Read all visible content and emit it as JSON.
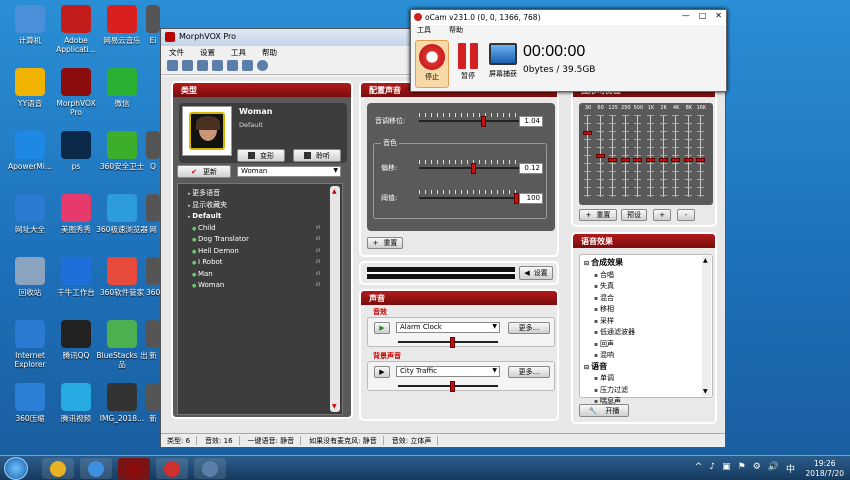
{
  "desktop_icons": [
    {
      "label": "计算机",
      "icon": "computer-icon",
      "color": "#4a8fd8",
      "col": 0,
      "row": 0
    },
    {
      "label": "Adobe Applicati...",
      "icon": "adobe-icon",
      "color": "#c31c1c",
      "col": 1,
      "row": 0
    },
    {
      "label": "网易云音乐",
      "icon": "netease-music-icon",
      "color": "#d9201f",
      "col": 2,
      "row": 0
    },
    {
      "label": "YY语音",
      "icon": "yy-icon",
      "color": "#f0b400",
      "col": 0,
      "row": 1
    },
    {
      "label": "MorphVOX Pro",
      "icon": "morphvox-icon",
      "color": "#8b0c0c",
      "col": 1,
      "row": 1
    },
    {
      "label": "微信",
      "icon": "wechat-icon",
      "color": "#2ab134",
      "col": 2,
      "row": 1
    },
    {
      "label": "ApowerMi...",
      "icon": "apowermirror-icon",
      "color": "#1e88e5",
      "col": 0,
      "row": 2
    },
    {
      "label": "ps",
      "icon": "photoshop-icon",
      "color": "#0b2a4a",
      "col": 1,
      "row": 2
    },
    {
      "label": "360安全卫士",
      "icon": "360-safe-icon",
      "color": "#3dae2b",
      "col": 2,
      "row": 2
    },
    {
      "label": "网址大全",
      "icon": "ie-icon",
      "color": "#2a7bd1",
      "col": 0,
      "row": 3
    },
    {
      "label": "美图秀秀",
      "icon": "meitu-icon",
      "color": "#e53a6b",
      "col": 1,
      "row": 3
    },
    {
      "label": "360极速浏览器",
      "icon": "360-browser-icon",
      "color": "#2d9cdb",
      "col": 2,
      "row": 3
    },
    {
      "label": "回收站",
      "icon": "recycle-bin-icon",
      "color": "#8aa4bf",
      "col": 0,
      "row": 4
    },
    {
      "label": "千牛工作台",
      "icon": "qianniu-icon",
      "color": "#1e6fd9",
      "col": 1,
      "row": 4
    },
    {
      "label": "360软件管家",
      "icon": "360-software-icon",
      "color": "#e84a3c",
      "col": 2,
      "row": 4
    },
    {
      "label": "Internet Explorer",
      "icon": "ie-icon",
      "color": "#2a7bd1",
      "col": 0,
      "row": 5
    },
    {
      "label": "腾讯QQ",
      "icon": "qq-icon",
      "color": "#222222",
      "col": 1,
      "row": 5
    },
    {
      "label": "BlueStacks 出品",
      "icon": "bluestacks-icon",
      "color": "#4caf50",
      "col": 2,
      "row": 5
    },
    {
      "label": "360压缩",
      "icon": "360-zip-icon",
      "color": "#2c7fd6",
      "col": 0,
      "row": 6
    },
    {
      "label": "腾讯视频",
      "icon": "tencent-video-icon",
      "color": "#27a9e1",
      "col": 1,
      "row": 6
    },
    {
      "label": "IMG_2018...",
      "icon": "image-thumbnail-icon",
      "color": "#333333",
      "col": 2,
      "row": 6
    }
  ],
  "partial_icons": [
    "Ei",
    "Q",
    "网",
    "360",
    "新",
    "新"
  ],
  "morphvox": {
    "title": "MorphVOX Pro",
    "menu": [
      "文件",
      "设置",
      "工具",
      "帮助"
    ],
    "voice_panel": {
      "header": "类型",
      "voice_name": "Woman",
      "voice_sub": "Default",
      "morph_btn": "变形",
      "listen_btn": "聆听",
      "update_btn": "更新",
      "select_value": "Woman",
      "tree": [
        {
          "label": "更多语音",
          "indent": 0,
          "bold": false
        },
        {
          "label": "显示收藏夹",
          "indent": 0,
          "bold": false
        },
        {
          "label": "Default",
          "indent": 0,
          "bold": true
        },
        {
          "label": "Child",
          "indent": 1,
          "bold": false
        },
        {
          "label": "Dog Translator",
          "indent": 1,
          "bold": false
        },
        {
          "label": "Hell Demon",
          "indent": 1,
          "bold": false
        },
        {
          "label": "I Robot",
          "indent": 1,
          "bold": false
        },
        {
          "label": "Man",
          "indent": 1,
          "bold": false
        },
        {
          "label": "Woman",
          "indent": 1,
          "bold": false
        }
      ]
    },
    "tweak_panel": {
      "header": "配置声音",
      "pitch_label": "音调移位:",
      "pitch_value": "1.04",
      "timbre_group": "音色",
      "bias_label": "偏移:",
      "bias_value": "0.12",
      "strength_label": "阈值:",
      "strength_value": "100",
      "reset_btn": "重置",
      "pitch_level": 0.65,
      "bias_level": 0.55,
      "strength_level": 1.0
    },
    "mic_panel": {
      "settings_btn": "设置"
    },
    "sound_panel": {
      "header": "声音",
      "effects_label": "音效",
      "effect_value": "Alarm Clock",
      "more_btn": "更多...",
      "bg_label": "背景声音",
      "bg_value": "City Traffic",
      "bg_more_btn": "更多...",
      "effect_volume": 0.55,
      "bg_volume": 0.55
    },
    "eq_panel": {
      "header": "图形均衡器",
      "bands": [
        "30",
        "60",
        "125",
        "250",
        "500",
        "1K",
        "2K",
        "4K",
        "8K",
        "16K"
      ],
      "levels": [
        0.8,
        0.5,
        0.45,
        0.45,
        0.45,
        0.45,
        0.45,
        0.45,
        0.45,
        0.45
      ],
      "reset_btn": "重置",
      "preset_btn": "预设",
      "add_btn": "+",
      "remove_btn": "-"
    },
    "effects_panel": {
      "header": "语音效果",
      "tree": [
        {
          "label": "合成效果",
          "indent": 0,
          "group": true
        },
        {
          "label": "合唱",
          "indent": 1,
          "group": false
        },
        {
          "label": "失真",
          "indent": 1,
          "group": false
        },
        {
          "label": "混合",
          "indent": 1,
          "group": false
        },
        {
          "label": "移相",
          "indent": 1,
          "group": false
        },
        {
          "label": "采样",
          "indent": 1,
          "group": false
        },
        {
          "label": "低通滤波器",
          "indent": 1,
          "group": false
        },
        {
          "label": "回声",
          "indent": 1,
          "group": false
        },
        {
          "label": "混响",
          "indent": 1,
          "group": false
        },
        {
          "label": "语音",
          "indent": 0,
          "group": true
        },
        {
          "label": "单调",
          "indent": 1,
          "group": false
        },
        {
          "label": "压力过滤",
          "indent": 1,
          "group": false
        },
        {
          "label": "喘息声",
          "indent": 1,
          "group": false
        }
      ],
      "tweak_btn": "开播"
    },
    "status": [
      "类型: 6",
      "音效: 16",
      "一键语音: 静音",
      "如果没有麦克风: 静音",
      "音效: 立体声"
    ]
  },
  "ocam": {
    "title": "oCam v231.0 (0, 0, 1366, 768)",
    "menu": [
      "工具",
      "帮助"
    ],
    "stop_label": "停止",
    "pause_label": "暂停",
    "screen_label": "屏幕捕获",
    "timer": "00:00:00",
    "size": "0bytes / 39.5GB",
    "controls": [
      "—",
      "□",
      "✕"
    ]
  },
  "taskbar": {
    "time": "19:26",
    "date": "2018/7/20",
    "apps": [
      "chrome-icon",
      "360-browser-icon",
      "morphvox-icon",
      "ocam-icon",
      "ocam-settings-icon"
    ],
    "tray": [
      "^",
      "♪",
      "▣",
      "⚑",
      "⚙",
      "🔊",
      "中"
    ]
  }
}
